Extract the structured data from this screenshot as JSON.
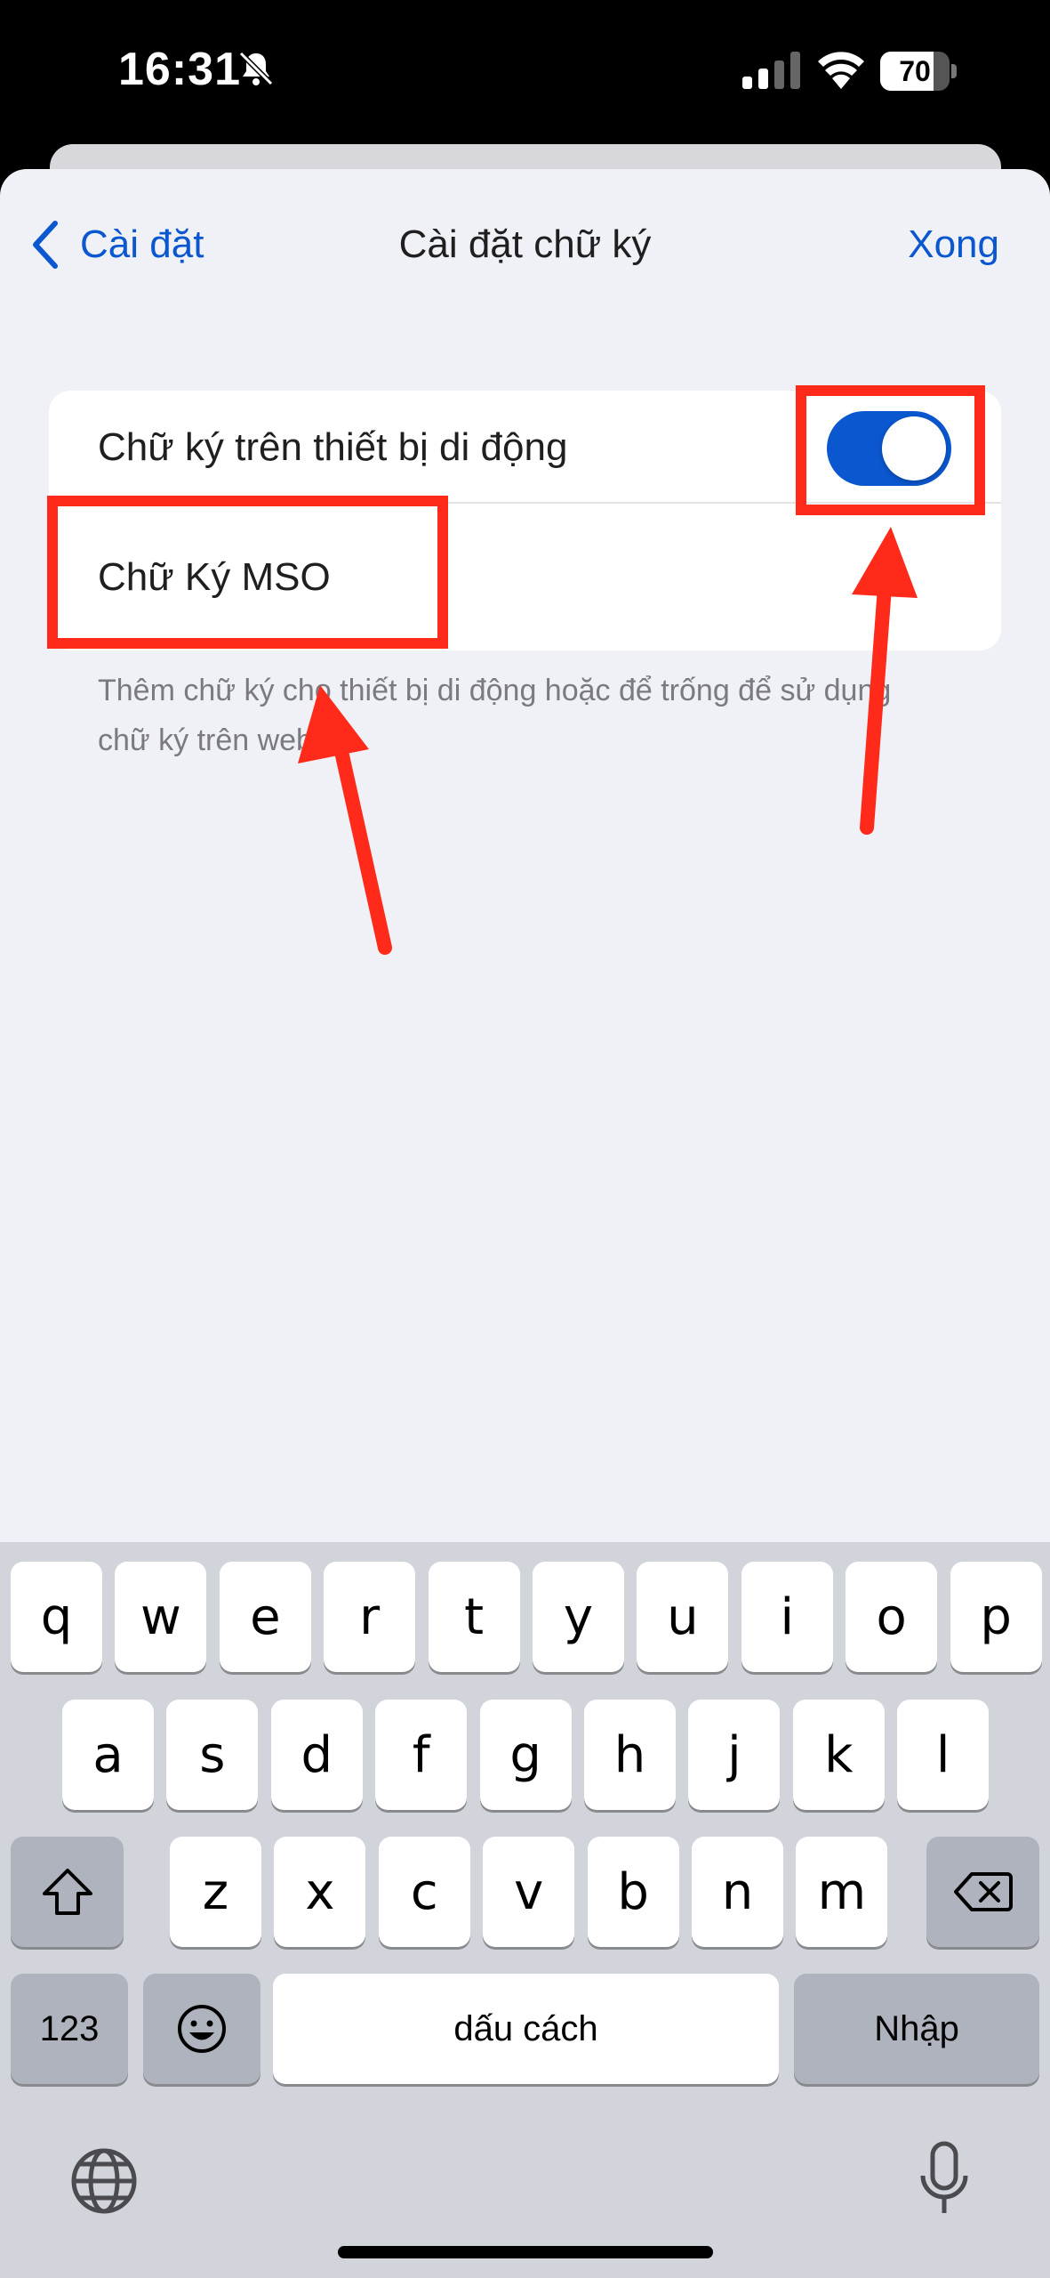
{
  "status_bar": {
    "time": "16:31",
    "battery_level": "70",
    "icons": [
      "bell-slash-icon",
      "cellular-signal-icon",
      "wifi-icon",
      "battery-icon"
    ]
  },
  "nav": {
    "back_label": "Cài đặt",
    "title": "Cài đặt chữ ký",
    "done_label": "Xong"
  },
  "settings": {
    "mobile_signature_label": "Chữ ký trên thiết bị di động",
    "mobile_signature_enabled": true,
    "signature_value": "Chữ Ký MSO",
    "helper_text": "Thêm chữ ký cho thiết bị di động hoặc để trống để sử dụng chữ ký trên web."
  },
  "keyboard": {
    "row1": [
      "q",
      "w",
      "e",
      "r",
      "t",
      "y",
      "u",
      "i",
      "o",
      "p"
    ],
    "row2": [
      "a",
      "s",
      "d",
      "f",
      "g",
      "h",
      "j",
      "k",
      "l"
    ],
    "row3": [
      "z",
      "x",
      "c",
      "v",
      "b",
      "n",
      "m"
    ],
    "numbers_label": "123",
    "space_label": "dấu cách",
    "return_label": "Nhập"
  },
  "colors": {
    "accent": "#0b57d0",
    "annotation": "#ff2a1a",
    "background": "#eff1f6"
  }
}
